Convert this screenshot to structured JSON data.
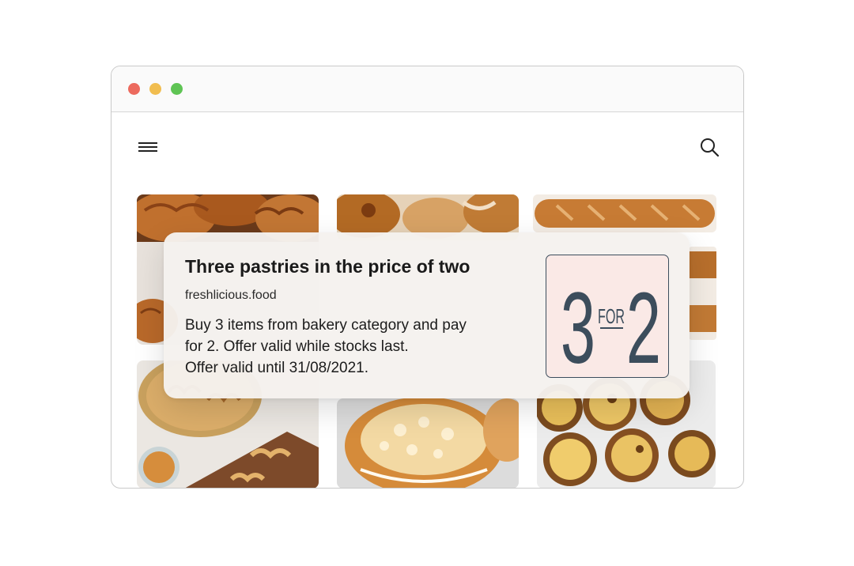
{
  "window": {
    "controls": [
      "close",
      "minimize",
      "maximize"
    ]
  },
  "toolbar": {
    "menu_icon": "hamburger-menu-icon",
    "search_icon": "search-icon"
  },
  "gallery": {
    "images": [
      "croissants",
      "danish-pastries",
      "baguettes",
      "palmiers-cookies",
      "glazed-crumble-bun",
      "egg-tarts"
    ]
  },
  "promo": {
    "title": "Three pastries in the price of two",
    "site": "freshlicious.food",
    "body_lines": [
      "Buy 3 items from bakery category and pay",
      "for 2. Offer valid while stocks last.",
      "Offer valid until 31/08/2021."
    ],
    "badge": {
      "left": "3",
      "middle": "FOR",
      "right": "2"
    }
  },
  "colors": {
    "close": "#ec6a5e",
    "minimize": "#f1bd4f",
    "maximize": "#5fc454",
    "badge_bg": "#fae9e6",
    "badge_ink": "#3c4d5c"
  }
}
